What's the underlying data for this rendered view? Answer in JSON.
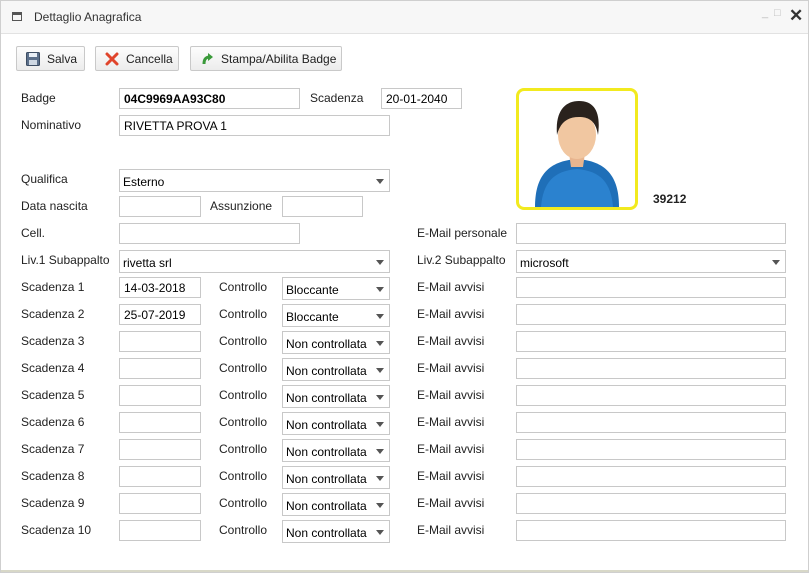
{
  "window": {
    "title": "Dettaglio Anagrafica",
    "minimize_icon": "minimize-icon",
    "maximize_icon": "maximize-icon",
    "close_icon": "close-icon"
  },
  "toolbar": {
    "save_label": "Salva",
    "cancel_label": "Cancella",
    "print_label": "Stampa/Abilita Badge"
  },
  "labels": {
    "badge": "Badge",
    "scadenza": "Scadenza",
    "nominativo": "Nominativo",
    "qualifica": "Qualifica",
    "data_nascita": "Data nascita",
    "assunzione": "Assunzione",
    "cell": "Cell.",
    "email_personale": "E-Mail personale",
    "liv1": "Liv.1 Subappalto",
    "liv2": "Liv.2 Subappalto"
  },
  "values": {
    "badge": "04C9969AA93C80",
    "scadenza": "20-01-2040",
    "nominativo": "RIVETTA PROVA 1",
    "qualifica": "Esterno",
    "data_nascita": "",
    "assunzione": "",
    "cell": "",
    "email_personale": "",
    "liv1": "rivetta srl",
    "liv2": "microsoft",
    "photo_id": "39212"
  },
  "rows": [
    {
      "label": "Scadenza 1",
      "date": "14-03-2018",
      "controllo_label": "Controllo",
      "controllo": "Bloccante",
      "email_label": "E-Mail avvisi",
      "email": ""
    },
    {
      "label": "Scadenza 2",
      "date": "25-07-2019",
      "controllo_label": "Controllo",
      "controllo": "Bloccante",
      "email_label": "E-Mail avvisi",
      "email": ""
    },
    {
      "label": "Scadenza 3",
      "date": "",
      "controllo_label": "Controllo",
      "controllo": "Non controllata",
      "email_label": "E-Mail avvisi",
      "email": ""
    },
    {
      "label": "Scadenza 4",
      "date": "",
      "controllo_label": "Controllo",
      "controllo": "Non controllata",
      "email_label": "E-Mail avvisi",
      "email": ""
    },
    {
      "label": "Scadenza 5",
      "date": "",
      "controllo_label": "Controllo",
      "controllo": "Non controllata",
      "email_label": "E-Mail avvisi",
      "email": ""
    },
    {
      "label": "Scadenza 6",
      "date": "",
      "controllo_label": "Controllo",
      "controllo": "Non controllata",
      "email_label": "E-Mail avvisi",
      "email": ""
    },
    {
      "label": "Scadenza 7",
      "date": "",
      "controllo_label": "Controllo",
      "controllo": "Non controllata",
      "email_label": "E-Mail avvisi",
      "email": ""
    },
    {
      "label": "Scadenza 8",
      "date": "",
      "controllo_label": "Controllo",
      "controllo": "Non controllata",
      "email_label": "E-Mail avvisi",
      "email": ""
    },
    {
      "label": "Scadenza 9",
      "date": "",
      "controllo_label": "Controllo",
      "controllo": "Non controllata",
      "email_label": "E-Mail avvisi",
      "email": ""
    },
    {
      "label": "Scadenza 10",
      "date": "",
      "controllo_label": "Controllo",
      "controllo": "Non controllata",
      "email_label": "E-Mail avvisi",
      "email": ""
    }
  ],
  "colors": {
    "photo_border": "#f2ea1f",
    "cancel_icon": "#e0442b",
    "print_icon": "#3a9a3a",
    "avatar_shirt": "#1f6fb8"
  }
}
